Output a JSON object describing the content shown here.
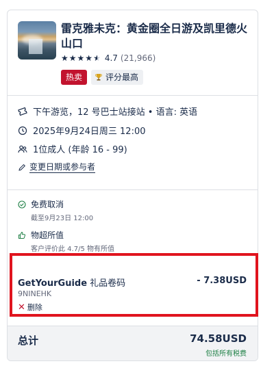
{
  "activity": {
    "title": "雷克雅未克：黄金圈全日游及凯里德火山口",
    "thumbnail_icon": "waterfall-photo",
    "rating": {
      "score": "4.7",
      "count": "(21,966)",
      "stars": 4.5
    },
    "badges": {
      "hot": "热卖",
      "top_rated": "评分最高",
      "top_rated_icon": "trophy-icon"
    }
  },
  "details": {
    "option": "下午游览，12 号巴士站接站 • 语言: 英语",
    "option_icon": "ticket-icon",
    "datetime": "2025年9月24日周三 12:00",
    "datetime_icon": "clock-icon",
    "participants": "1位成人 (年龄 16 - 99)",
    "participants_icon": "people-icon",
    "change_link": "变更日期或参与者",
    "change_icon": "pencil-icon"
  },
  "benefits": [
    {
      "title": "免费取消",
      "subtitle": "截至9月23日 12:00",
      "icon": "check-circle-icon"
    },
    {
      "title": "物超所值",
      "subtitle": "客户评价此 4.7/5 物有所值",
      "icon": "thumbs-up-icon"
    }
  ],
  "promo": {
    "brand": "GetYourGuide",
    "label": " 礼品卷码",
    "amount": "- 7.38USD",
    "code": "9NINEHK",
    "remove": "删除"
  },
  "total": {
    "label": "总计",
    "value": "74.58USD",
    "tax_note": "包括所有税费"
  },
  "colors": {
    "text": "#1a2b49",
    "hot_badge": "#c2132e",
    "highlight": "#e0141e",
    "tax_green": "#1f8046"
  }
}
